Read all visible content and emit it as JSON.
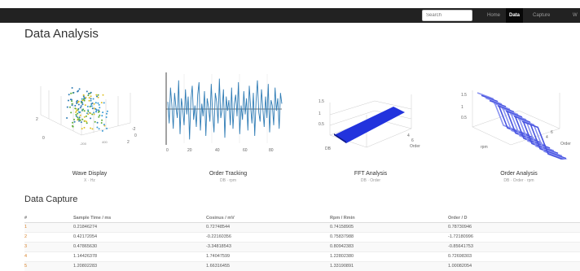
{
  "navbar": {
    "search_placeholder": "Search",
    "items": [
      "Home",
      "Data",
      "Capture",
      "W"
    ],
    "active": "Data"
  },
  "page_title": "Data Analysis",
  "charts": [
    {
      "title": "Wave Display",
      "subtitle": "X · Hz"
    },
    {
      "title": "Order Tracking",
      "subtitle": "DB · rpm"
    },
    {
      "title": "FFT Analysis",
      "subtitle": "DB · Order"
    },
    {
      "title": "Order Analysis",
      "subtitle": "DB · Order · rpm"
    }
  ],
  "line_chart": {
    "x_ticks": [
      "0",
      "20",
      "40",
      "60",
      "80"
    ],
    "series": [
      0.4,
      -0.8,
      1.2,
      0.2,
      -1.1,
      0.9,
      0.1,
      -0.5,
      1.6,
      -1.4,
      0.6,
      0.0,
      -0.9,
      1.1,
      -0.3,
      0.7,
      -1.7,
      0.5,
      1.3,
      -0.6,
      0.2,
      -1.0,
      0.8,
      1.5,
      -1.2,
      0.3,
      -0.4,
      1.0,
      -1.5,
      0.6,
      0.1,
      -0.7,
      1.4,
      -0.2,
      -1.3,
      0.9,
      0.4,
      -0.8,
      1.7,
      -0.5,
      0.0,
      1.1,
      -1.6,
      0.7,
      -0.1,
      0.5,
      -0.9,
      1.2,
      -1.1,
      0.3,
      0.8,
      -0.4,
      1.5,
      -1.4,
      0.2,
      -0.6,
      1.0,
      -0.3,
      0.6,
      -1.2,
      1.3,
      0.1,
      -0.8,
      0.9,
      -1.5,
      0.4,
      1.6,
      -0.2,
      -0.7,
      1.1,
      0.0,
      -1.0,
      0.7,
      -0.5,
      1.4,
      -1.3,
      0.5,
      0.2,
      -0.9,
      1.2,
      -0.1,
      0.6,
      -1.1,
      0.9,
      0.3
    ]
  },
  "scatter_labels": {
    "z": [
      "2",
      "0"
    ],
    "x": [
      "-200",
      "400"
    ],
    "y": [
      "-2",
      "0",
      "2"
    ]
  },
  "fft_labels": {
    "z": [
      "1.5",
      "1",
      "0.5"
    ],
    "x": [
      "DB",
      "4",
      "6"
    ],
    "y": [
      "Order"
    ]
  },
  "order_labels": {
    "z": [
      "1.5",
      "1",
      "0.5"
    ],
    "x": [
      "rpm",
      "4",
      "6"
    ],
    "y": [
      "Order"
    ]
  },
  "section_title": "Data Capture",
  "table": {
    "headers": [
      "#",
      "Sample Time / ms",
      "Cosinus / mV",
      "Rpm / Rmin",
      "Order / D"
    ],
    "rows": [
      [
        "1",
        "0.21846274",
        "0.72748544",
        "0.74158905",
        "0.78730946"
      ],
      [
        "2",
        "0.42172054",
        "-0.22160356",
        "0.75837988",
        "-1.72180996"
      ],
      [
        "3",
        "0.47865630",
        "-3.34818543",
        "0.80942383",
        "-0.85641753"
      ],
      [
        "4",
        "1.14426378",
        "1.74047599",
        "1.22802380",
        "0.72698303"
      ],
      [
        "5",
        "1.20802283",
        "1.66316455",
        "1.33190891",
        "1.00082054"
      ]
    ]
  }
}
